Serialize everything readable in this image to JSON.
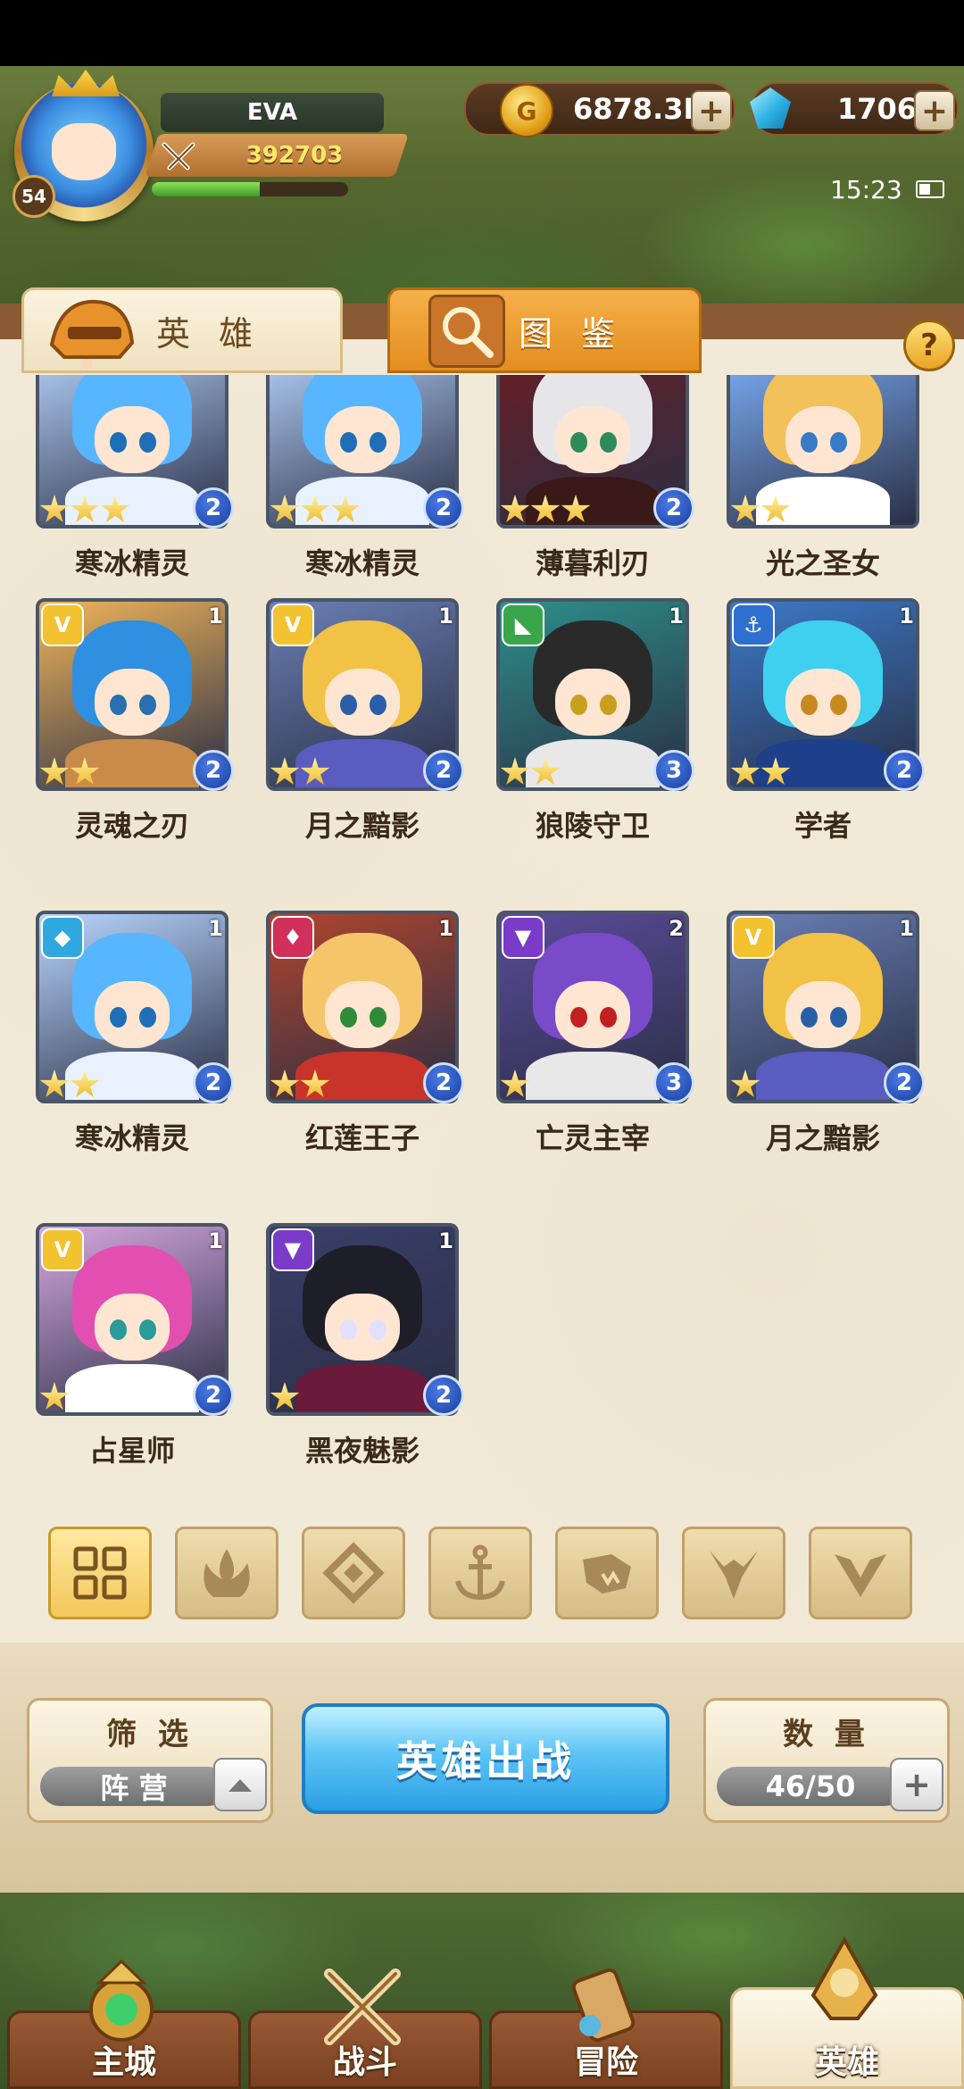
{
  "player": {
    "name": "EVA",
    "power": "392703",
    "level": "54",
    "xp_fraction": 0.55
  },
  "currency": {
    "gold": "6878.3K",
    "gems": "1706",
    "plus": "+"
  },
  "status": {
    "time": "15:23"
  },
  "tabs": {
    "heroes": "英 雄",
    "codex": "图 鉴",
    "help": "?"
  },
  "heroes": [
    {
      "name": "寒冰精灵",
      "stars": 3,
      "grade": "2",
      "count": "",
      "faction": "",
      "theme": "ice"
    },
    {
      "name": "寒冰精灵",
      "stars": 3,
      "grade": "2",
      "count": "",
      "faction": "",
      "theme": "ice"
    },
    {
      "name": "薄暮利刃",
      "stars": 3,
      "grade": "2",
      "count": "",
      "faction": "",
      "theme": "dusk"
    },
    {
      "name": "光之圣女",
      "stars": 2,
      "grade": "",
      "count": "",
      "faction": "",
      "theme": "light"
    },
    {
      "name": "灵魂之刃",
      "stars": 2,
      "grade": "2",
      "count": "1",
      "faction": "gold-v",
      "theme": "blade"
    },
    {
      "name": "月之黯影",
      "stars": 2,
      "grade": "2",
      "count": "1",
      "faction": "gold-v",
      "theme": "moon"
    },
    {
      "name": "狼陵守卫",
      "stars": 2,
      "grade": "3",
      "count": "1",
      "faction": "green-beast",
      "theme": "wolf"
    },
    {
      "name": "学者",
      "stars": 2,
      "grade": "2",
      "count": "1",
      "faction": "blue-anchor",
      "theme": "scholar"
    },
    {
      "name": "寒冰精灵",
      "stars": 2,
      "grade": "2",
      "count": "1",
      "faction": "cyan-diamond",
      "theme": "ice"
    },
    {
      "name": "红莲王子",
      "stars": 2,
      "grade": "2",
      "count": "1",
      "faction": "red-flame",
      "theme": "prince"
    },
    {
      "name": "亡灵主宰",
      "stars": 1,
      "grade": "3",
      "count": "2",
      "faction": "purple-horn",
      "theme": "undead"
    },
    {
      "name": "月之黯影",
      "stars": 1,
      "grade": "2",
      "count": "1",
      "faction": "gold-v",
      "theme": "moon"
    },
    {
      "name": "占星师",
      "stars": 1,
      "grade": "2",
      "count": "1",
      "faction": "gold-v",
      "theme": "astro"
    },
    {
      "name": "黑夜魅影",
      "stars": 1,
      "grade": "2",
      "count": "1",
      "faction": "purple-horn",
      "theme": "night"
    }
  ],
  "filters": [
    "grid-icon",
    "flame-icon",
    "diamond-icon",
    "anchor-icon",
    "beast-icon",
    "horn-icon",
    "v-icon"
  ],
  "controls": {
    "filter_title": "筛 选",
    "filter_value": "阵 营",
    "deploy": "英雄出战",
    "count_title": "数 量",
    "count_value": "46/50"
  },
  "nav": [
    "主城",
    "战斗",
    "冒险",
    "英雄"
  ]
}
